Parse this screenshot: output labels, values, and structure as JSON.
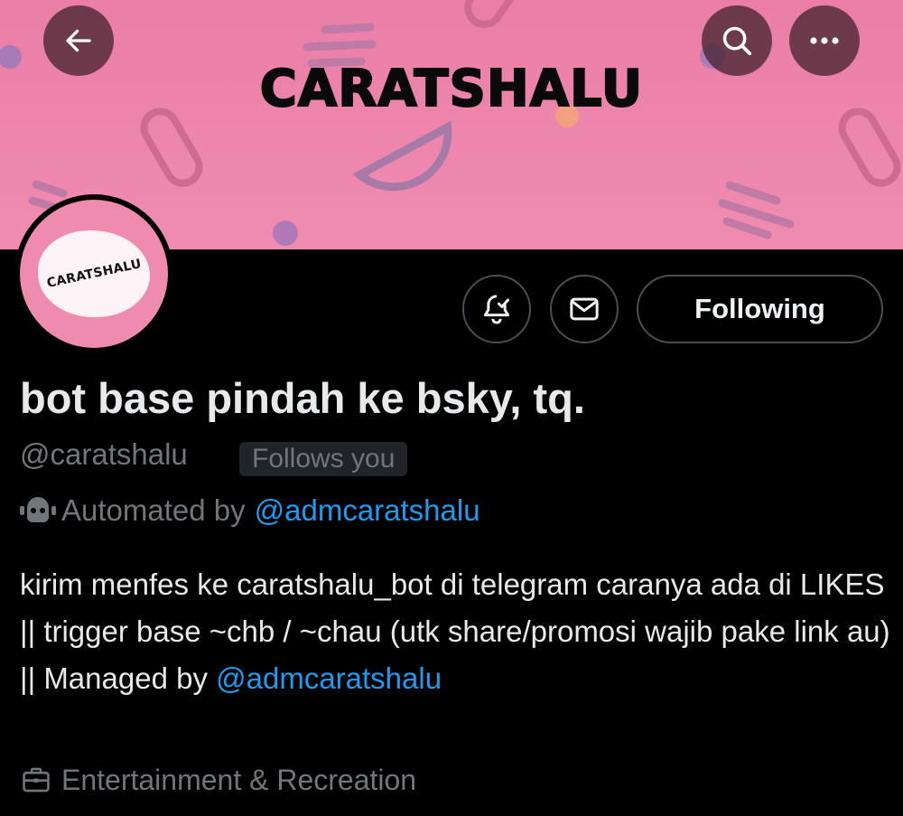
{
  "banner": {
    "title": "CARATSHALU",
    "color": "#ef88ae"
  },
  "header": {
    "back_icon": "arrow-left-icon",
    "search_icon": "search-icon",
    "more_icon": "more-horizontal-icon"
  },
  "avatar": {
    "text": "CARATSHALU"
  },
  "actions": {
    "notify_icon": "bell-check-icon",
    "message_icon": "envelope-icon",
    "following_label": "Following"
  },
  "profile": {
    "display_name": "bot base pindah ke bsky, tq.",
    "handle": "@caratshalu",
    "follows_you": "Follows you",
    "automated_prefix": "Automated by",
    "automated_link": "@admcaratshalu",
    "bio_text": "kirim menfes ke caratshalu_bot di telegram caranya ada di LIKES || trigger base ~chb / ~chau (utk share/promosi wajib pake link au) || Managed by",
    "bio_link": "@admcaratshalu",
    "category": "Entertainment & Recreation"
  },
  "colors": {
    "link": "#1d9bf0",
    "muted": "#71767b",
    "background": "#000000"
  }
}
